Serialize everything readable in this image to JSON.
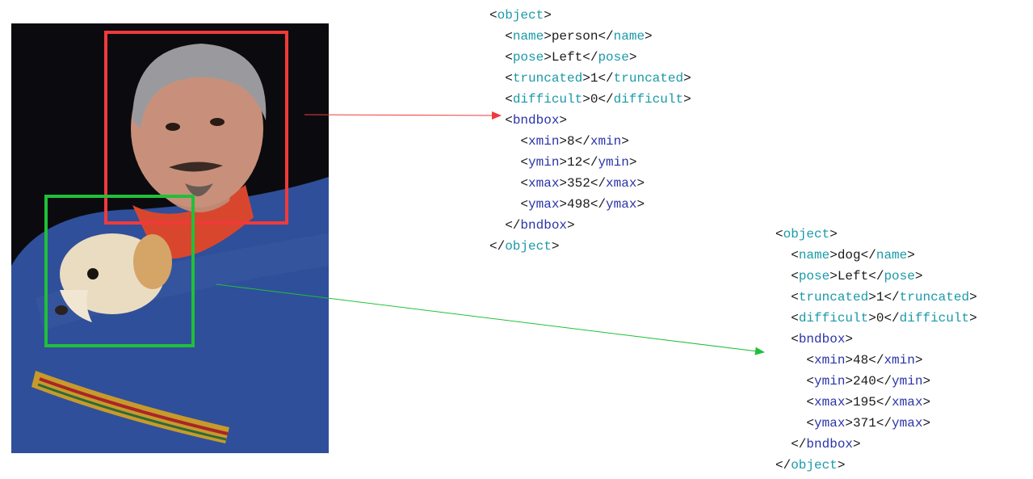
{
  "colors": {
    "person_box": "#f03a3a",
    "dog_box": "#1fc03a",
    "tag_teal": "#1a9aa8",
    "tag_blue": "#2a35a8"
  },
  "photo": {
    "description_icon": "photo-man-with-dog-icon"
  },
  "annotations": [
    {
      "color": "#f03a3a",
      "lines": [
        {
          "indent": 0,
          "tag": "object",
          "close": false,
          "value": null
        },
        {
          "indent": 1,
          "tag": "name",
          "value": "person"
        },
        {
          "indent": 1,
          "tag": "pose",
          "value": "Left"
        },
        {
          "indent": 1,
          "tag": "truncated",
          "value": "1"
        },
        {
          "indent": 1,
          "tag": "difficult",
          "value": "0"
        },
        {
          "indent": 1,
          "tag": "bndbox",
          "close": false,
          "value": null
        },
        {
          "indent": 2,
          "tag": "xmin",
          "value": "8"
        },
        {
          "indent": 2,
          "tag": "ymin",
          "value": "12"
        },
        {
          "indent": 2,
          "tag": "xmax",
          "value": "352"
        },
        {
          "indent": 2,
          "tag": "ymax",
          "value": "498"
        },
        {
          "indent": 1,
          "tag": "bndbox",
          "close": true,
          "value": null
        },
        {
          "indent": 0,
          "tag": "object",
          "close": true,
          "value": null
        }
      ]
    },
    {
      "color": "#1fc03a",
      "lines": [
        {
          "indent": 0,
          "tag": "object",
          "close": false,
          "value": null
        },
        {
          "indent": 1,
          "tag": "name",
          "value": "dog"
        },
        {
          "indent": 1,
          "tag": "pose",
          "value": "Left"
        },
        {
          "indent": 1,
          "tag": "truncated",
          "value": "1"
        },
        {
          "indent": 1,
          "tag": "difficult",
          "value": "0"
        },
        {
          "indent": 1,
          "tag": "bndbox",
          "close": false,
          "value": null
        },
        {
          "indent": 2,
          "tag": "xmin",
          "value": "48"
        },
        {
          "indent": 2,
          "tag": "ymin",
          "value": "240"
        },
        {
          "indent": 2,
          "tag": "xmax",
          "value": "195"
        },
        {
          "indent": 2,
          "tag": "ymax",
          "value": "371"
        },
        {
          "indent": 1,
          "tag": "bndbox",
          "close": true,
          "value": null
        },
        {
          "indent": 0,
          "tag": "object",
          "close": true,
          "value": null
        }
      ]
    }
  ]
}
